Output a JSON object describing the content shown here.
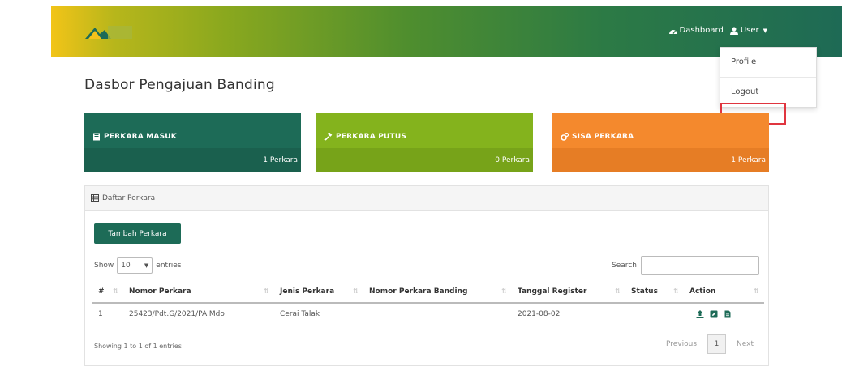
{
  "navbar": {
    "dashboard_label": "Dashboard",
    "user_label": "User",
    "dropdown": {
      "profile_label": "Profile",
      "logout_label": "Logout"
    }
  },
  "page": {
    "title": "Dasbor Pengajuan Banding"
  },
  "cards": [
    {
      "title": "PERKARA MASUK",
      "count": "1 Perkara",
      "icon": "book-icon",
      "color": "#1d6b57"
    },
    {
      "title": "PERKARA PUTUS",
      "count": "0 Perkara",
      "icon": "gavel-icon",
      "color": "#84b31d"
    },
    {
      "title": "SISA PERKARA",
      "count": "1 Perkara",
      "icon": "cogs-icon",
      "color": "#f4892d"
    }
  ],
  "panel": {
    "title": "Daftar Perkara",
    "add_button": "Tambah Perkara",
    "show_label": "Show",
    "entries_label": "entries",
    "page_length": "10",
    "search_label": "Search:",
    "search_value": "",
    "columns": [
      "#",
      "Nomor Perkara",
      "Jenis Perkara",
      "Nomor Perkara Banding",
      "Tanggal Register",
      "Status",
      "Action"
    ],
    "rows": [
      {
        "no": "1",
        "nomor_perkara": "25423/Pdt.G/2021/PA.Mdo",
        "jenis_perkara": "Cerai Talak",
        "nomor_banding": "",
        "tanggal_register": "2021-08-02",
        "status": ""
      }
    ],
    "info": "Showing 1 to 1 of 1 entries",
    "pagination": {
      "previous": "Previous",
      "current_page": "1",
      "next": "Next"
    }
  },
  "colors": {
    "primary": "#1d6b57",
    "success": "#84b31d",
    "warning": "#f4892d",
    "highlight": "#e0353f"
  }
}
